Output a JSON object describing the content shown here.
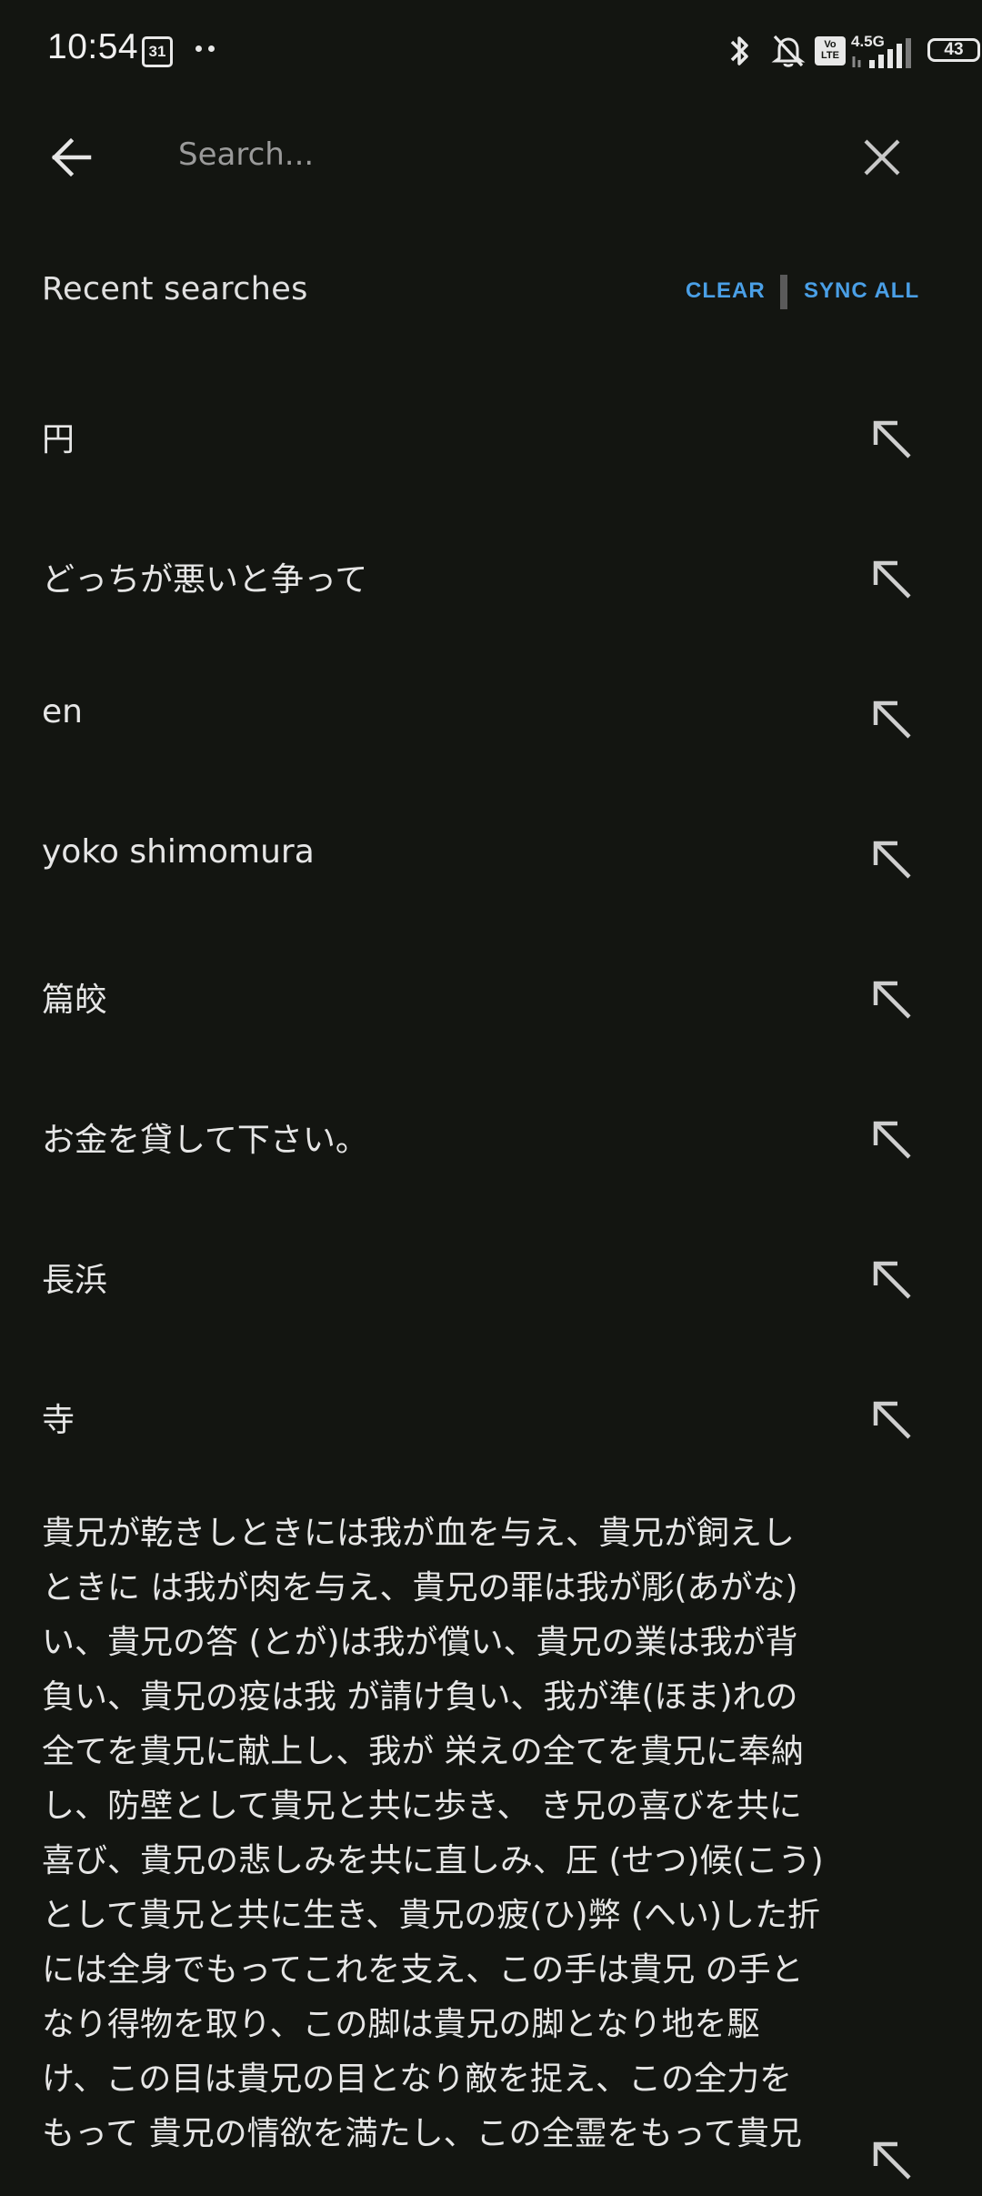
{
  "status_bar": {
    "time": "10:54",
    "calendar_day": "31",
    "network_type": "4.5G",
    "volte_label": "Vo LTE",
    "battery": "43",
    "icons": [
      "calendar-icon",
      "overflow-dots-icon",
      "bluetooth-icon",
      "bell-off-icon",
      "volte-icon",
      "signal-icon",
      "battery-icon"
    ]
  },
  "search": {
    "placeholder": "Search...",
    "value": "",
    "back_icon": "arrow-left-icon",
    "close_icon": "close-icon"
  },
  "recent": {
    "title": "Recent searches",
    "clear_label": "CLEAR",
    "sync_label": "SYNC ALL",
    "items": [
      {
        "label": "円"
      },
      {
        "label": "どっちが悪いと争って"
      },
      {
        "label": "en"
      },
      {
        "label": "yoko shimomura"
      },
      {
        "label": "篇皎"
      },
      {
        "label": "お金を貸して下さい。"
      },
      {
        "label": "長浜"
      },
      {
        "label": "寺"
      }
    ],
    "long_item": {
      "label": "貴兄が乾きしときには我が血を与え、貴兄が飼えしときに は我が肉を与え、貴兄の罪は我が彫(あがな)い、貴兄の答 (とが)は我が償い、貴兄の業は我が背負い、貴兄の疫は我 が請け負い、我が準(ほま)れの全てを貴兄に献上し、我が 栄えの全てを貴兄に奉納し、防壁として貴兄と共に歩き、 き兄の喜びを共に喜び、貴兄の悲しみを共に直しみ、圧 (せつ)候(こう)として貴兄と共に生き、貴兄の疲(ひ)弊 (へい)した折には全身でもってこれを支え、この手は貴兄 の手となり得物を取り、この脚は貴兄の脚となり地を駆 け、この目は貴兄の目となり敵を捉え、この全力をもって 貴兄の情欲を満たし、この全霊をもって貴兄"
    },
    "fill_icon": "arrow-up-left-icon"
  },
  "colors": {
    "background": "#131511",
    "text": "#e6e6e6",
    "accent": "#4a9fe6",
    "muted": "#9a9a9a"
  }
}
